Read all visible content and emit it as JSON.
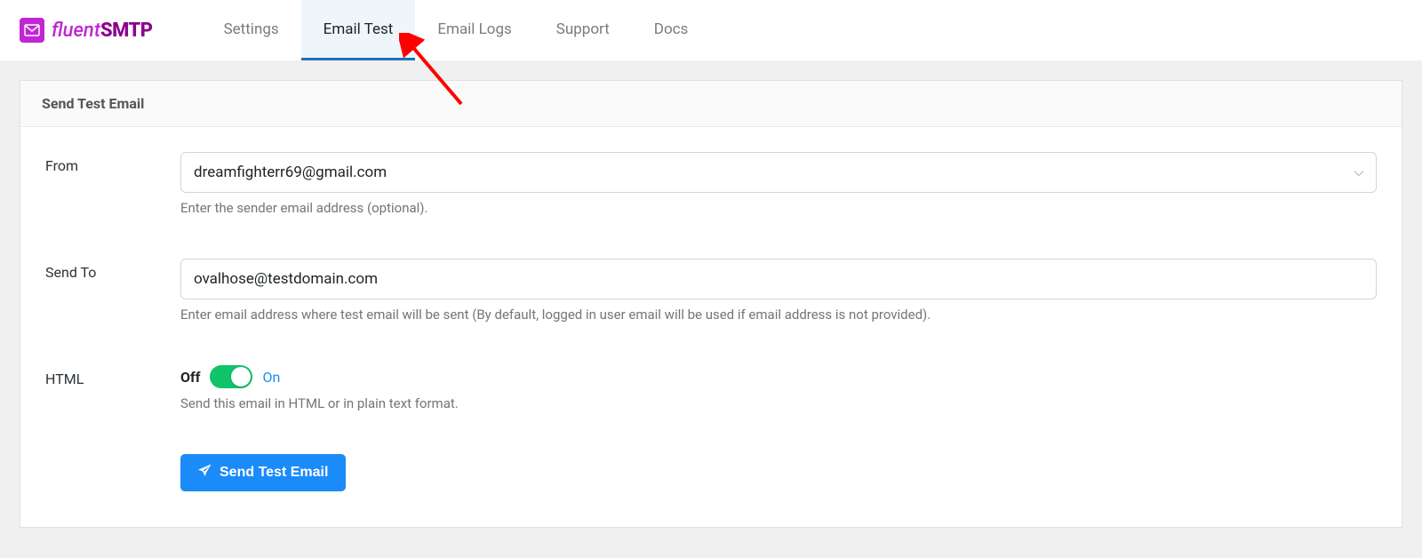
{
  "brand": {
    "fluent": "fluent",
    "smtp": "SMTP"
  },
  "tabs": {
    "settings": "Settings",
    "email_test": "Email Test",
    "email_logs": "Email Logs",
    "support": "Support",
    "docs": "Docs"
  },
  "panel": {
    "title": "Send Test Email",
    "from": {
      "label": "From",
      "value": "dreamfighterr69@gmail.com",
      "hint": "Enter the sender email address (optional)."
    },
    "send_to": {
      "label": "Send To",
      "value": "ovalhose@testdomain.com",
      "hint": "Enter email address where test email will be sent (By default, logged in user email will be used if email address is not provided)."
    },
    "html": {
      "label": "HTML",
      "off": "Off",
      "on": "On",
      "hint": "Send this email in HTML or in plain text format."
    },
    "submit": "Send Test Email"
  }
}
